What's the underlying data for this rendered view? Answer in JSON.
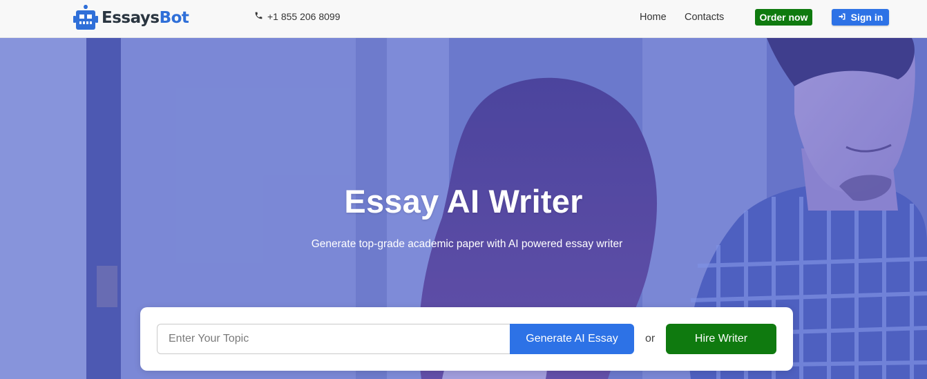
{
  "brand": {
    "name_part1": "Essays",
    "name_part2": "Bot",
    "primary_color": "#2d72e6",
    "accent_green": "#0f7a0f"
  },
  "header": {
    "phone": "+1 855 206 8099",
    "nav": {
      "home": "Home",
      "contacts": "Contacts"
    },
    "order_label": "Order now",
    "signin_label": "Sign in"
  },
  "hero": {
    "title": "Essay AI Writer",
    "subtitle": "Generate top-grade academic paper with AI powered essay writer",
    "search": {
      "placeholder": "Enter Your Topic",
      "value": "",
      "generate_label": "Generate AI Essay",
      "or_text": "or",
      "hire_label": "Hire Writer"
    }
  },
  "icons": {
    "logo": "robot-icon",
    "phone": "phone-icon",
    "signin": "sign-in-icon"
  }
}
